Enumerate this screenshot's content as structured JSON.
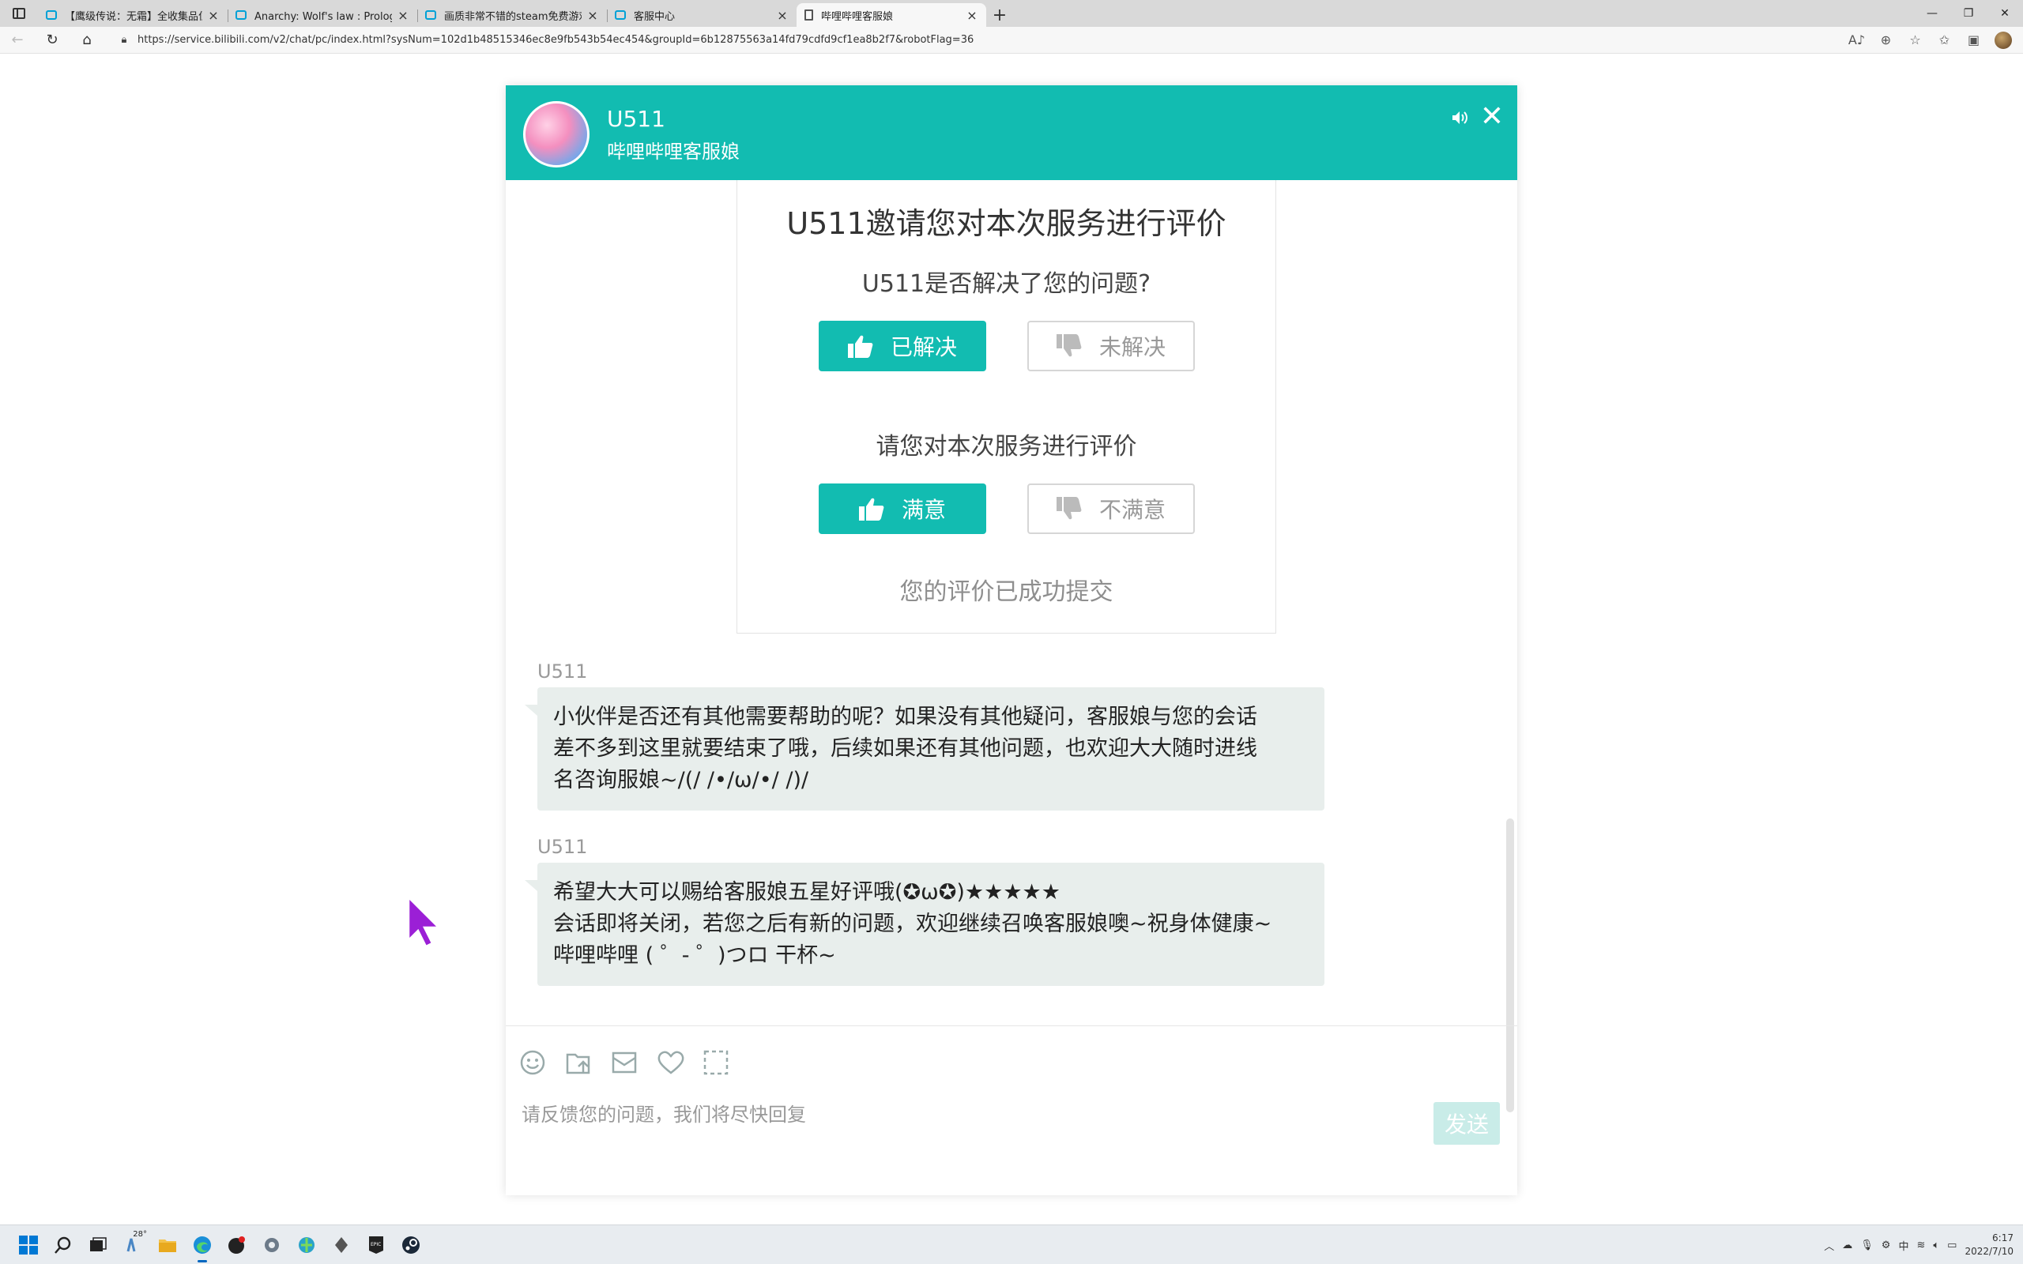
{
  "browser": {
    "tabs": [
      {
        "title": "【鹰级传说：无霜】全收集品位置",
        "icon": "bilibili-icon",
        "active": false
      },
      {
        "title": "Anarchy: Wolf's law : Prologue_哔",
        "icon": "bilibili-icon",
        "active": false
      },
      {
        "title": "画质非常不错的steam免费游戏，",
        "icon": "bilibili-icon",
        "active": false
      },
      {
        "title": "客服中心",
        "icon": "bilibili-icon",
        "active": false
      },
      {
        "title": "哔哩哔哩客服娘",
        "icon": "document-icon",
        "active": true
      }
    ],
    "url": "https://service.bilibili.com/v2/chat/pc/index.html?sysNum=102d1b48515346ec8e9fb543b54ec454&groupId=6b12875563a14fd79cdfd9cf1ea8b2f7&robotFlag=36"
  },
  "chat": {
    "agent_name": "U511",
    "agent_role": "哔哩哔哩客服娘",
    "rating": {
      "title": "U511邀请您对本次服务进行评价",
      "question1": "U511是否解决了您的问题?",
      "resolved_label": "已解决",
      "unresolved_label": "未解决",
      "question2": "请您对本次服务进行评价",
      "satisfied_label": "满意",
      "unsatisfied_label": "不满意",
      "status": "您的评价已成功提交"
    },
    "messages": [
      {
        "sender": "U511",
        "lines": [
          "小伙伴是否还有其他需要帮助的呢？如果没有其他疑问，客服娘与您的会话",
          "差不多到这里就要结束了哦，后续如果还有其他问题，也欢迎大大随时进线",
          "名咨询服娘~/(/ /•/ω/•/ /)/"
        ]
      },
      {
        "sender": "U511",
        "lines": [
          "希望大大可以赐给客服娘五星好评哦(✪ω✪)★★★★★",
          "会话即将关闭，若您之后有新的问题，欢迎继续召唤客服娘噢~祝身体健康~",
          "哔哩哔哩 ( ゜- ゜)つロ 干杯~"
        ]
      }
    ],
    "input_placeholder": "请反馈您的问题，我们将尽快回复",
    "send_label": "发送"
  },
  "taskbar": {
    "weather_temp": "28°",
    "time": "6:17",
    "date": "2022/7/10"
  },
  "colors": {
    "accent": "#12bcb1",
    "bubble": "#e8eeec"
  }
}
